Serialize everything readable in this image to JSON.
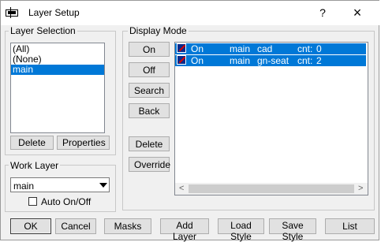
{
  "window": {
    "title": "Layer Setup",
    "help": "?",
    "close": "×"
  },
  "layer_selection": {
    "label": "Layer Selection",
    "items": [
      "(All)",
      "(None)",
      "main"
    ],
    "selected_index": 2,
    "delete_label": "Delete",
    "properties_label": "Properties"
  },
  "work_layer": {
    "label": "Work Layer",
    "value": "main",
    "auto_label": "Auto On/Off",
    "auto_checked": false
  },
  "display_mode": {
    "label": "Display Mode",
    "buttons": {
      "on": "On",
      "off": "Off",
      "search": "Search",
      "back": "Back",
      "delete": "Delete",
      "override": "Override"
    },
    "rows": [
      {
        "state": "On",
        "layer": "main",
        "name": "cad",
        "cnt_label": "cnt:",
        "cnt": "0"
      },
      {
        "state": "On",
        "layer": "main",
        "name": "gn-seat",
        "cnt_label": "cnt:",
        "cnt": "2"
      }
    ],
    "scroll_left": "<",
    "scroll_right": ">"
  },
  "bottom": {
    "ok": "OK",
    "cancel": "Cancel",
    "masks": "Masks",
    "add_layer": "Add Layer",
    "load_style": "Load Style",
    "save_style": "Save Style",
    "list": "List"
  },
  "colors": {
    "selection": "#0078d7",
    "face": "#f0f0f0"
  }
}
